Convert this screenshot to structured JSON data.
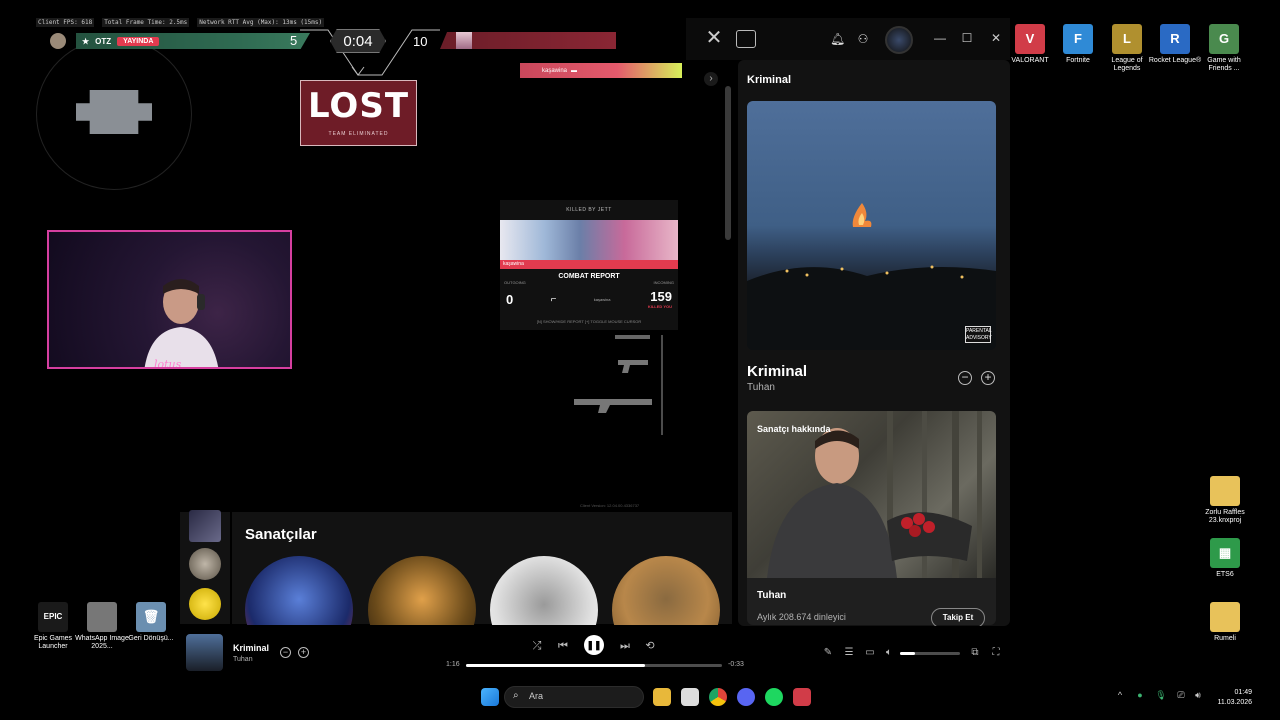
{
  "hud": {
    "stats": [
      "Client FPS: 618",
      "Total Frame Time: 2.5ms",
      "Network RTT Avg (Max): 13ms (15ms)"
    ],
    "team_tag": "OTZ",
    "live_badge": "YAYINDA",
    "score_left": "5",
    "timer": "0:04",
    "score_right": "10",
    "killfeed_name": "kaşawina",
    "lost_title": "LOST",
    "lost_sub": "TEAM ELIMINATED",
    "webcam_label": "lotus",
    "combat": {
      "killed_by": "KILLED BY JETT",
      "strip_name": "kaşawina",
      "title": "COMBAT REPORT",
      "outgoing_label": "OUTGOING",
      "incoming_label": "INCOMING",
      "outgoing_value": "0",
      "incoming_value": "159",
      "incoming_sub": "KILLED YOU",
      "weapon_name": "kaşawina",
      "footer": "[N] SHOW/HIDE REPORT   [+] TOGGLE MOUSE CURSOR"
    },
    "client_version": "Client Version: 12.04.00.4336737"
  },
  "spotify": {
    "now_playing_header": "Kriminal",
    "track_title": "Kriminal",
    "track_artist": "Tuhan",
    "about_label": "Sanatçı hakkında",
    "about_artist": "Tuhan",
    "monthly_listeners": "Aylık 208.674 dinleyici",
    "follow_label": "Takip Et",
    "artists_title": "Sanatçılar",
    "explicit_label": "PARENTAL ADVISORY",
    "player": {
      "title": "Kriminal",
      "artist": "Tuhan",
      "time_elapsed": "1:16",
      "time_remaining": "-0:33",
      "progress_fraction": 0.7,
      "volume_fraction": 0.25
    }
  },
  "desktop_right": [
    {
      "label": "VALORANT",
      "color": "#d13c48",
      "glyph": "V"
    },
    {
      "label": "Fortnite",
      "color": "#2f8ad6",
      "glyph": "F"
    },
    {
      "label": "League of Legends",
      "color": "#b0902f",
      "glyph": "L"
    },
    {
      "label": "Rocket League®",
      "color": "#2a6ac4",
      "glyph": "R"
    },
    {
      "label": "Game with Friends ...",
      "color": "#4a8a4e",
      "glyph": "G"
    }
  ],
  "desktop_side": [
    {
      "label": "Zorlu Raffles 23.knxproj",
      "color": "#e8c25a",
      "glyph": ""
    },
    {
      "label": "ETS6",
      "color": "#2e9a4a",
      "glyph": "▦"
    },
    {
      "label": "Rumeli",
      "color": "#e8c25a",
      "glyph": ""
    }
  ],
  "desktop_left": [
    {
      "label": "Epic Games Launcher",
      "color": "#1a1a1a",
      "glyph": "EPIC"
    },
    {
      "label": "WhatsApp Image 2025...",
      "color": "#777",
      "glyph": ""
    },
    {
      "label": "Geri Dönüşü...",
      "color": "#6b8fb0",
      "glyph": "🗑"
    }
  ],
  "taskbar": {
    "search_placeholder": "Ara",
    "time": "01:49",
    "date": "11.03.2026"
  }
}
